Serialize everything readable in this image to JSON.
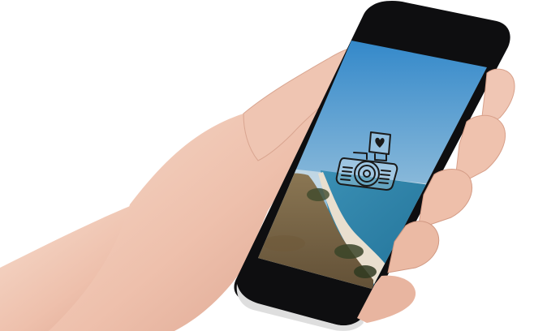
{
  "scene": {
    "subject": "hand-holding-smartphone",
    "screen_content": "camera-icon-over-coastal-landscape",
    "icon": "camera-heart-icon"
  },
  "colors": {
    "background": "#ffffff",
    "phone_body": "#0d0d0f",
    "phone_bezel": "#1b1b1f",
    "sky_top": "#2f86c9",
    "sky_bottom": "#c9dde8",
    "sea": "#2a7fa6",
    "beach": "#e6dccb",
    "hill": "#7d6a4c",
    "skin_light": "#f2d2c2",
    "skin_mid": "#e6b6a2",
    "skin_shadow": "#c98f7b",
    "icon_stroke": "#1a1a1a"
  }
}
